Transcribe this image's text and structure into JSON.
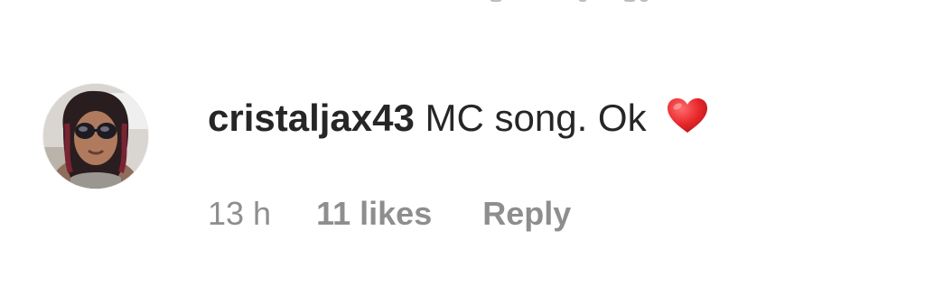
{
  "comment": {
    "username": "cristaljax43",
    "text": "MC song. Ok",
    "emoji": "heart-emoji",
    "time": "13 h",
    "likes": "11 likes",
    "reply_label": "Reply"
  },
  "colors": {
    "text_primary": "#262626",
    "text_secondary": "#8e8e8e",
    "heart_red": "#e8282b"
  }
}
